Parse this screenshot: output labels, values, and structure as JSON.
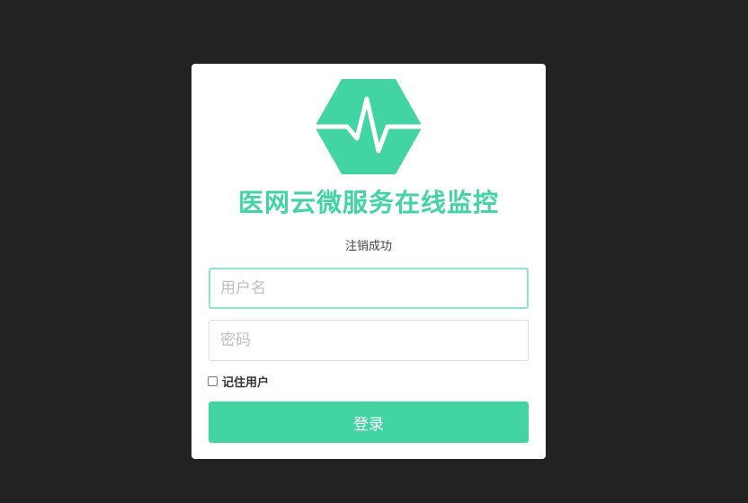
{
  "app": {
    "title": "医网云微服务在线监控",
    "logo_icon": "heartbeat-hexagon-icon",
    "accent_color": "#42d4a2",
    "background_color": "#222222"
  },
  "message": "注销成功",
  "form": {
    "username": {
      "value": "",
      "placeholder": "用户名",
      "focused": true
    },
    "password": {
      "value": "",
      "placeholder": "密码"
    },
    "remember_label": "记住用户",
    "remember_checked": false,
    "login_label": "登录"
  }
}
